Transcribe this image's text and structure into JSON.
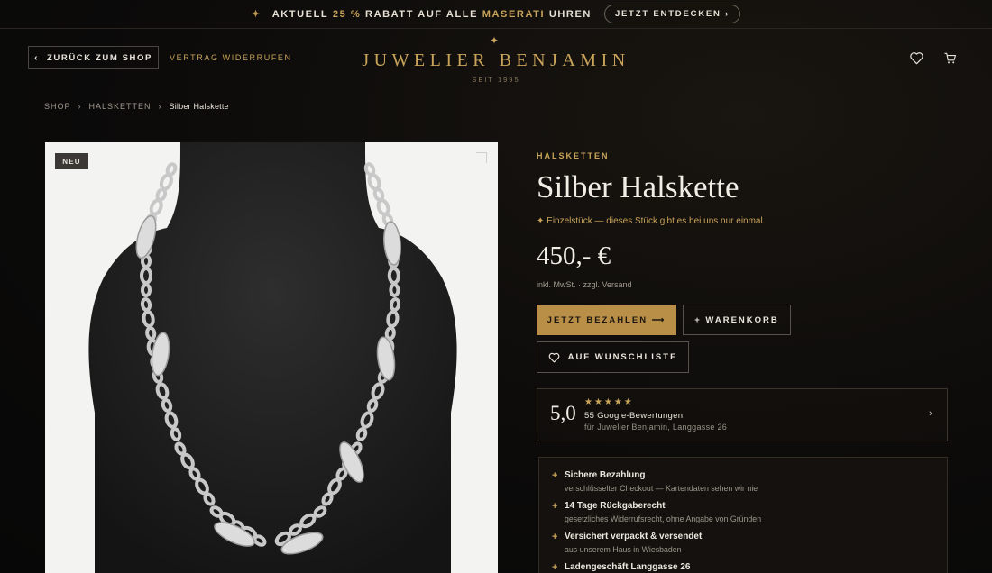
{
  "promo": {
    "prefix": "AKTUELL",
    "discount": "25 %",
    "middle": "RABATT AUF ALLE",
    "brand": "MASERATI",
    "suffix": "UHREN",
    "cta": "JETZT ENTDECKEN ›"
  },
  "header": {
    "back_label": "ZURÜCK ZUM SHOP",
    "withdraw_label": "VERTRAG WIDERRUFEN",
    "logo": "JUWELIER BENJAMIN",
    "logo_sub": "SEIT 1995",
    "icons": [
      "heart-icon",
      "cart-icon"
    ]
  },
  "breadcrumb": {
    "items": [
      "SHOP",
      "HALSKETTEN"
    ],
    "separator": "›",
    "current": "Silber Halskette"
  },
  "gallery": {
    "badge": "NEU"
  },
  "product": {
    "category": "HALSKETTEN",
    "title": "Silber Halskette",
    "unique_note": "✦ Einzelstück — dieses Stück gibt es bei uns nur einmal.",
    "price": "450,- €",
    "tax_note": "inkl. MwSt. · zzgl. Versand",
    "pay_label": "JETZT BEZAHLEN ⟶",
    "cart_label": "+ WARENKORB",
    "wishlist_label": "AUF WUNSCHLISTE"
  },
  "review": {
    "score": "5,0",
    "stars": "★★★★★",
    "count": "55 Google-Bewertungen",
    "location": "für Juwelier Benjamin, Langgasse 26",
    "arrow": "›"
  },
  "trust": [
    {
      "title": "Sichere Bezahlung",
      "desc": "verschlüsselter Checkout — Kartendaten sehen wir nie"
    },
    {
      "title": "14 Tage Rückgaberecht",
      "desc": "gesetzliches Widerrufsrecht, ohne Angabe von Gründen"
    },
    {
      "title": "Versichert verpackt & versendet",
      "desc": "aus unserem Haus in Wiesbaden"
    },
    {
      "title": "Ladengeschäft Langgasse 26",
      "desc": ""
    }
  ],
  "colors": {
    "gold": "#c9a45a",
    "button_gold": "#b98f48",
    "background": "#0c0b0a"
  }
}
